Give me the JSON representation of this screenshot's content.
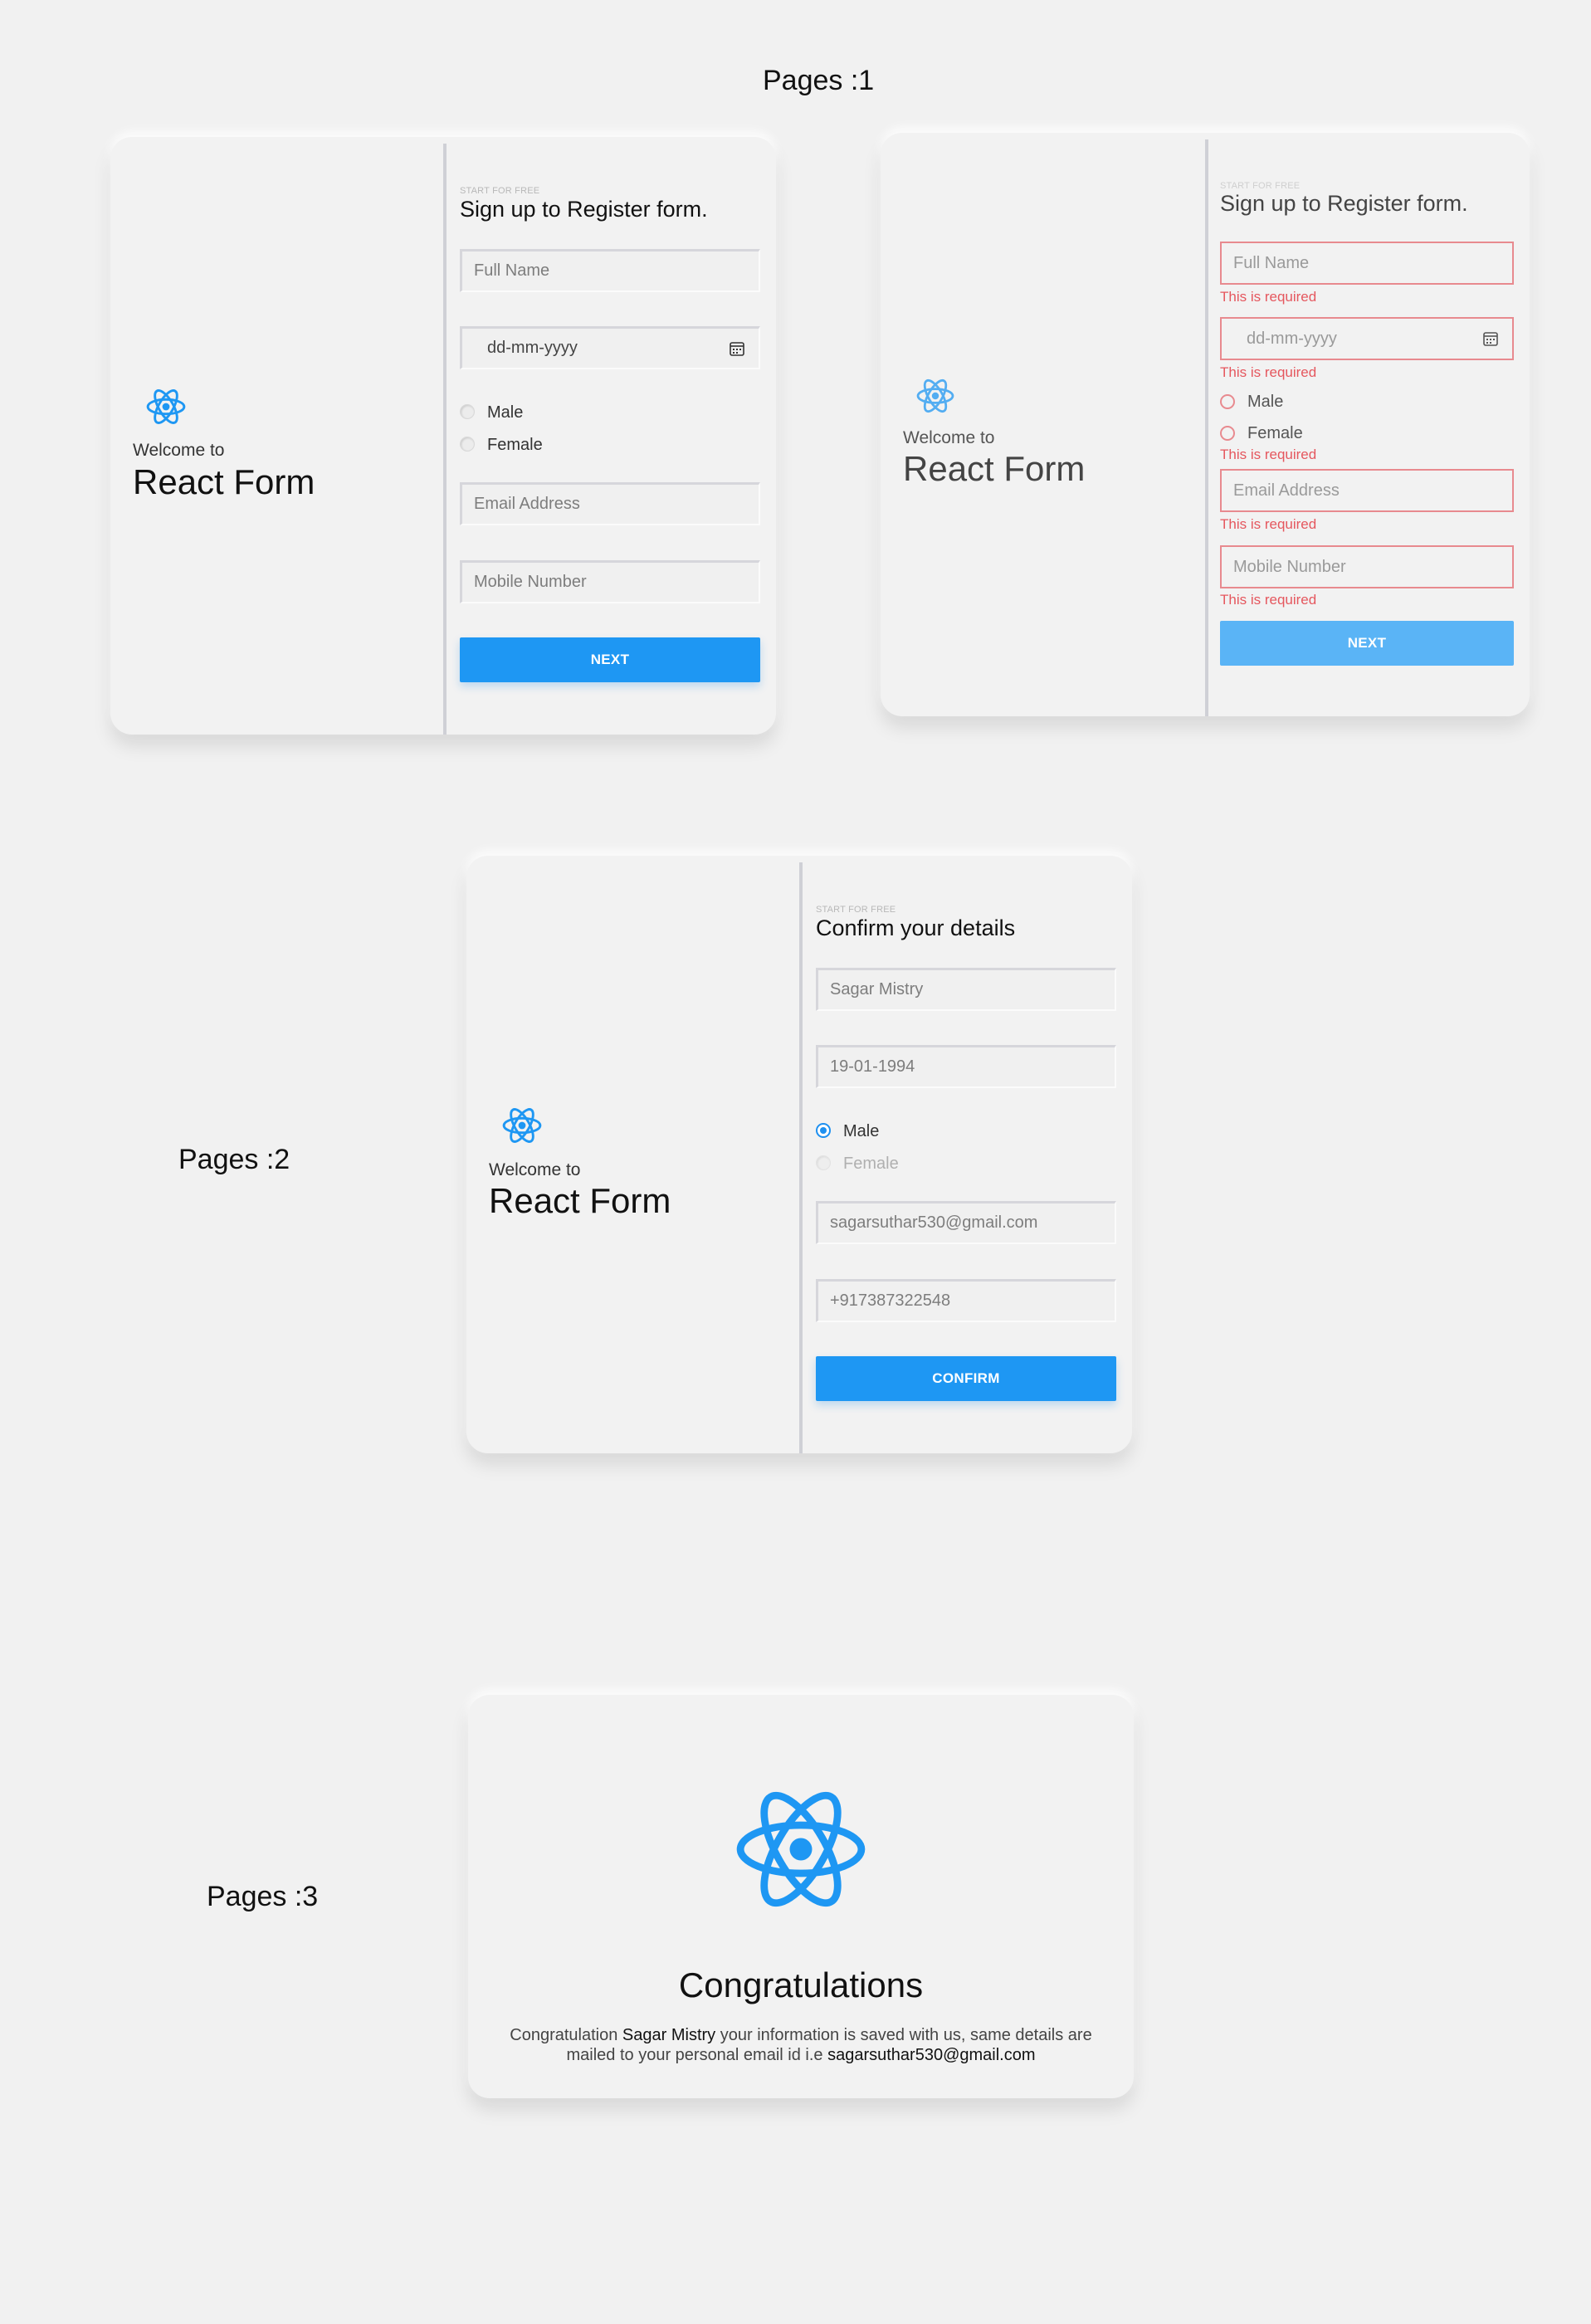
{
  "pages": {
    "page1_label": "Pages :1",
    "page2_label": "Pages :2",
    "page3_label": "Pages :3"
  },
  "brand": {
    "welcome": "Welcome to",
    "title": "React Form",
    "logo_icon": "react-atom-icon",
    "color": "#1e97f3"
  },
  "register": {
    "eyebrow": "START FOR FREE",
    "title": "Sign up to Register form.",
    "fullname_placeholder": "Full Name",
    "dob_placeholder": "dd-mm-yyyy",
    "gender_male": "Male",
    "gender_female": "Female",
    "email_placeholder": "Email Address",
    "mobile_placeholder": "Mobile Number",
    "next_label": "NEXT",
    "required_msg": "This is required"
  },
  "confirm": {
    "eyebrow": "START FOR FREE",
    "title": "Confirm your details",
    "fullname": "Sagar Mistry",
    "dob": "19-01-1994",
    "gender_male": "Male",
    "gender_female": "Female",
    "selected_gender": "Male",
    "email": "sagarsuthar530@gmail.com",
    "mobile": "+917387322548",
    "confirm_label": "CONFIRM"
  },
  "success": {
    "title": "Congratulations",
    "text_prefix": "Congratulation ",
    "name": "Sagar Mistry",
    "text_middle": " your information is saved with us, same details are mailed to your personal email id i.e ",
    "email": "sagarsuthar530@gmail.com"
  },
  "colors": {
    "accent": "#1e97f3",
    "error": "#e5575e",
    "background": "#f1f1f1"
  }
}
